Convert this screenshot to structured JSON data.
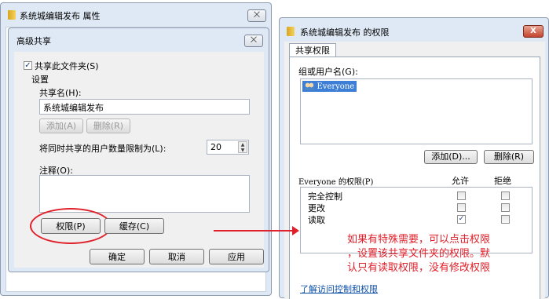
{
  "props_window": {
    "title": "系统城编辑发布 属性",
    "close": "⨉"
  },
  "adv_dialog": {
    "title": "高级共享",
    "close": "⨉",
    "share_checkbox": "共享此文件夹(S)",
    "settings_label": "设置",
    "share_name_label": "共享名(H):",
    "share_name_value": "系统城编辑发布",
    "add_button": "添加(A)",
    "remove_button": "删除(R)",
    "limit_label": "将同时共享的用户数量限制为(L):",
    "limit_value": "20",
    "comment_label": "注释(O):",
    "permissions_button": "权限(P)",
    "cache_button": "缓存(C)",
    "ok_button": "确定",
    "cancel_button": "取消",
    "apply_button": "应用"
  },
  "perm_dialog": {
    "title": "系统城编辑发布 的权限",
    "close": "X",
    "tab": "共享权限",
    "group_label": "组或用户名(G):",
    "users": [
      "Everyone"
    ],
    "add_button": "添加(D)...",
    "remove_button": "删除(R)",
    "perm_header": "Everyone 的权限(P)",
    "allow_header": "允许",
    "deny_header": "拒绝",
    "permissions": [
      {
        "name": "完全控制",
        "allow": false,
        "deny": false
      },
      {
        "name": "更改",
        "allow": false,
        "deny": false
      },
      {
        "name": "读取",
        "allow": true,
        "deny": false
      }
    ],
    "link": "了解访问控制和权限"
  },
  "annotation": {
    "lines": [
      "如果有特殊需要，可以点击权限",
      "，设置该共享文件夹的权限。默",
      "认只有读取权限，没有修改权限"
    ],
    "color": "#e0202a"
  }
}
